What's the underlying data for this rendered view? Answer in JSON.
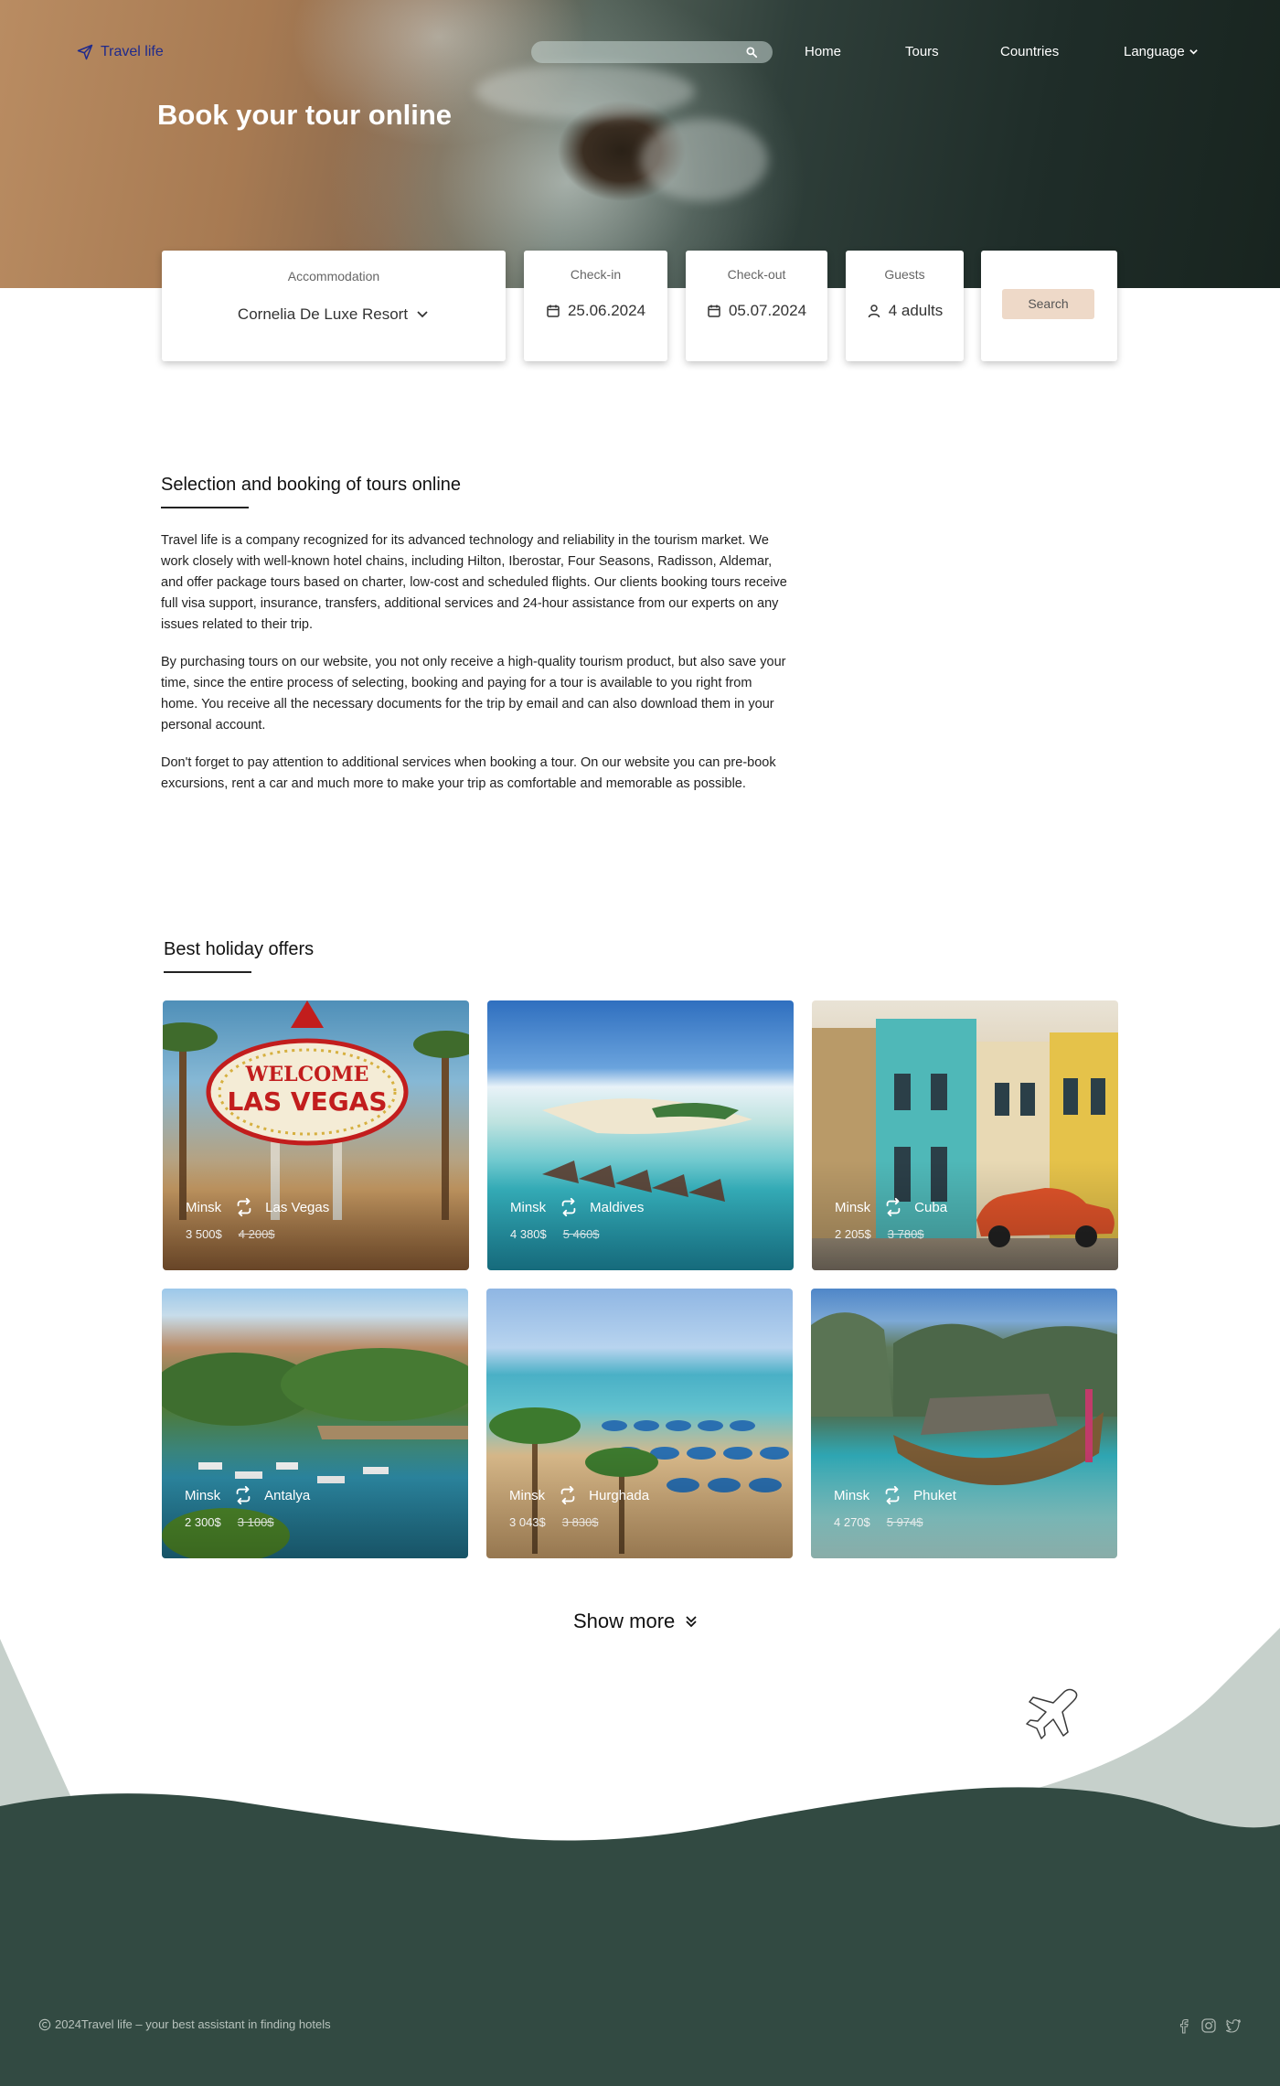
{
  "header": {
    "logo_text": "Travel life",
    "search_placeholder": "",
    "nav": [
      "Home",
      "Tours",
      "Countries",
      "Language"
    ]
  },
  "hero": {
    "title": "Book your tour online"
  },
  "booking": {
    "accommodation_label": "Accommodation",
    "accommodation_value": "Cornelia De Luxe Resort",
    "checkin_label": "Check-in",
    "checkin_value": "25.06.2024",
    "checkout_label": "Check-out",
    "checkout_value": "05.07.2024",
    "guests_label": "Guests",
    "guests_value": "4 adults",
    "search_label": "Search"
  },
  "about": {
    "title": "Selection and booking of tours online",
    "paragraphs": [
      "Travel life is a company recognized for its advanced technology and reliability in the tourism market.  We work closely with well-known hotel chains, including Hilton, Iberostar, Four Seasons, Radisson, Aldemar, and offer package tours based on charter, low-cost and scheduled flights.  Our clients booking tours receive full visa support, insurance, transfers, additional services and 24-hour assistance from our experts on any issues related to their trip.",
      "By purchasing tours on our website, you not only receive a high-quality tourism product, but also save your time, since the entire process of selecting, booking and paying for a tour is available to you right from home.  You receive all the necessary documents for the trip by email and can also download them in your personal account.",
      "Don't forget to pay attention to additional services when booking a tour.  On our website you can pre-book excursions, rent a car and much more to make your trip as comfortable and memorable as possible."
    ]
  },
  "offers": {
    "title": "Best holiday offers",
    "items": [
      {
        "from": "Minsk",
        "to": "Las Vegas",
        "price": "3 500$",
        "old_price": "4 200$"
      },
      {
        "from": "Minsk",
        "to": "Maldives",
        "price": "4 380$",
        "old_price": "5 460$"
      },
      {
        "from": "Minsk",
        "to": "Cuba",
        "price": "2 205$",
        "old_price": "3 780$"
      },
      {
        "from": "Minsk",
        "to": "Antalya",
        "price": "2 300$",
        "old_price": "3 100$"
      },
      {
        "from": "Minsk",
        "to": "Hurghada",
        "price": "3 043$",
        "old_price": "3 830$"
      },
      {
        "from": "Minsk",
        "to": "Phuket",
        "price": "4 270$",
        "old_price": "5 974$"
      }
    ],
    "show_more_label": "Show more"
  },
  "footer": {
    "copyright": "2024Travel life – your best assistant in finding hotels",
    "social_icons": [
      "facebook-icon",
      "instagram-icon",
      "twitter-icon"
    ]
  },
  "colors": {
    "brand_blue": "#1f2a8c",
    "footer_green": "#324a42",
    "search_button": "#eed9c8",
    "footer_light": "#c6d0cb"
  }
}
